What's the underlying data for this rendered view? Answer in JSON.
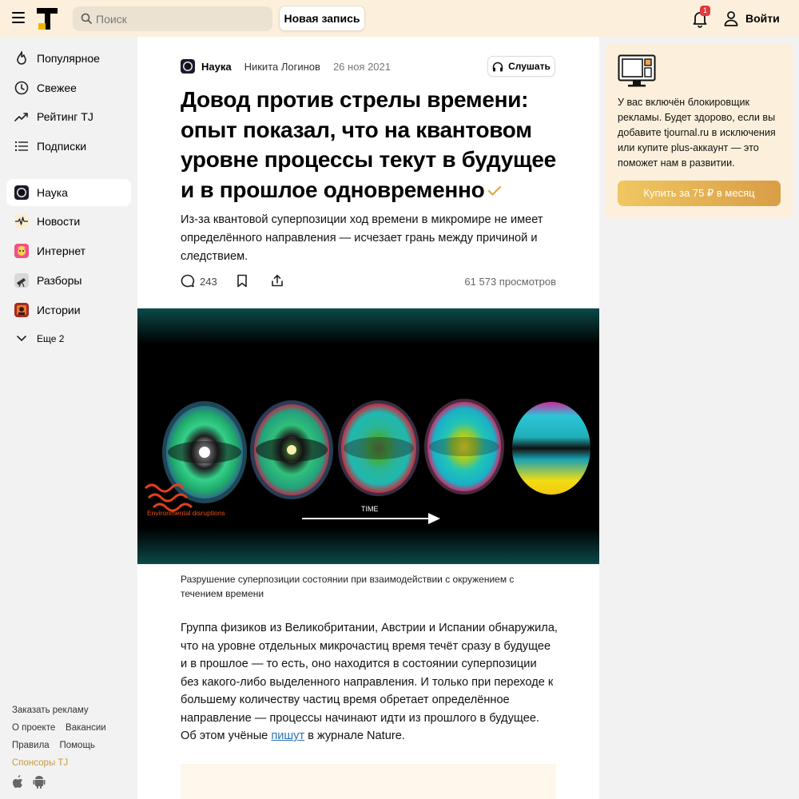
{
  "header": {
    "search_placeholder": "Поиск",
    "new_post_label": "Новая запись",
    "notification_count": "1",
    "login_label": "Войти"
  },
  "sidebar": {
    "main_items": [
      {
        "label": "Популярное",
        "icon": "flame-icon"
      },
      {
        "label": "Свежее",
        "icon": "clock-icon"
      },
      {
        "label": "Рейтинг TJ",
        "icon": "trending-icon"
      },
      {
        "label": "Подписки",
        "icon": "list-icon"
      }
    ],
    "sub_items": [
      {
        "label": "Наука",
        "icon": "science-subsite-icon",
        "active": true
      },
      {
        "label": "Новости",
        "icon": "news-subsite-icon"
      },
      {
        "label": "Интернет",
        "icon": "internet-subsite-icon"
      },
      {
        "label": "Разборы",
        "icon": "analysis-subsite-icon"
      },
      {
        "label": "Истории",
        "icon": "stories-subsite-icon"
      }
    ],
    "more_label": "Еще 2",
    "footer": {
      "ads": "Заказать рекламу",
      "about": "О проекте",
      "jobs": "Вакансии",
      "rules": "Правила",
      "help": "Помощь",
      "sponsors": "Спонсоры TJ"
    }
  },
  "article": {
    "category": "Наука",
    "author": "Никита Логинов",
    "date": "26 ноя 2021",
    "listen_label": "Слушать",
    "title": "Довод против стрелы времени: опыт показал, что на квантовом уровне процессы текут в будущее и в прошлое одновременно",
    "lead": "Из-за квантовой суперпозиции ход времени в микромире не имеет определённого направления — исчезает грань между причиной и следствием.",
    "comments_count": "243",
    "views": "61 573 просмотров",
    "figure": {
      "label_disruptions": "Environmental disruptions",
      "label_time": "TIME"
    },
    "caption": "Разрушение суперпозиции состоянии при взаимодействии с окружением с течением времени",
    "body_before_link": "Группа физиков из Великобритании, Австрии и Испании обнаружила, что на уровне отдельных микрочастиц время течёт сразу в будущее и в прошлое — то есть, оно находится в состоянии суперпозиции без какого-либо выделенного направления. И только при переходе к большему количеству частиц время обретает определённое направление — процессы начинают идти из прошлого в будущее. Об этом учёные ",
    "body_link": "пишут",
    "body_after_link": " в журнале Nature."
  },
  "ad": {
    "text": "У вас включён блокировщик рекламы. Будет здорово, если вы добавите tjournal.ru в исключения или купите plus-аккаунт — это поможет нам в развитии.",
    "button_label": "Купить за 75 ₽ в месяц"
  },
  "colors": {
    "header_bg": "#fcf0dc",
    "accent_gold": "#d99d46",
    "badge_red": "#e03a3a",
    "link_blue": "#2a72b5"
  }
}
